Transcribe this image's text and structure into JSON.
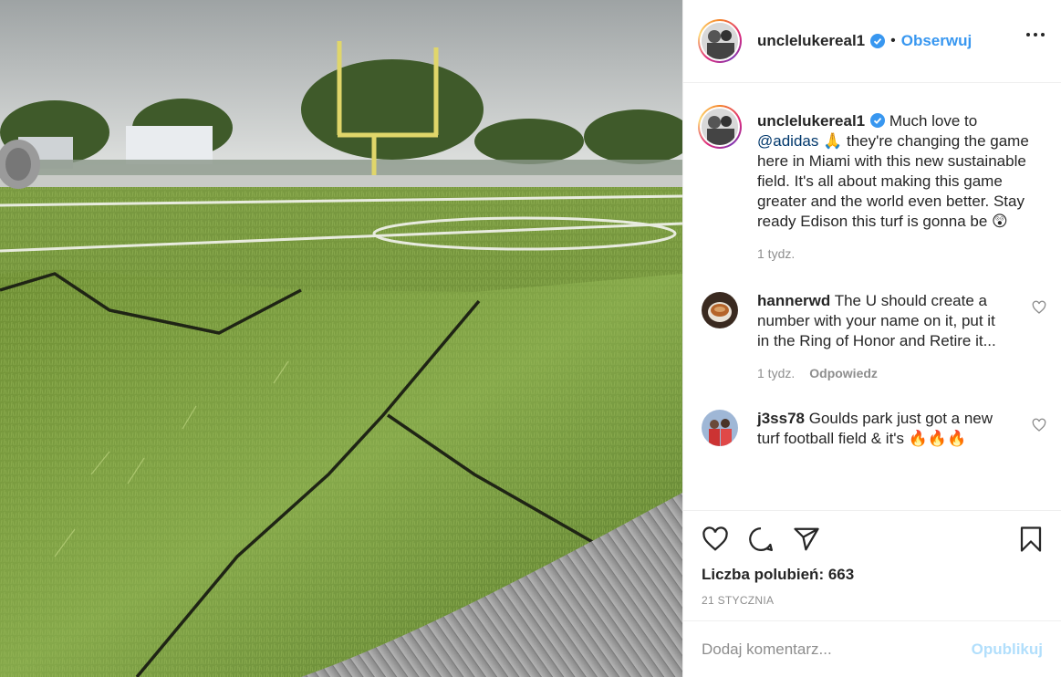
{
  "post": {
    "username": "unclelukereal1",
    "follow_label": "Obserwuj",
    "separator": "•"
  },
  "caption": {
    "username": "unclelukereal1",
    "text_before_mention": " Much love to ",
    "mention": "@adidas",
    "text_after_mention": " 🙏 they're changing the game here in Miami with this new sustainable field. It's all about making this game greater and the world even better. Stay ready Edison this turf is gonna be 😲",
    "time": "1 tydz."
  },
  "comments": [
    {
      "username": "hannerwd",
      "text": " The U should create a number with your name on it, put it in the Ring of Honor and Retire it...",
      "time": "1 tydz.",
      "reply_label": "Odpowiedz",
      "avatar_icon": "coffee-cup-avatar"
    },
    {
      "username": "j3ss78",
      "text": " Goulds park just got a new turf football field & it's 🔥🔥🔥",
      "avatar_icon": "group-photo-avatar"
    }
  ],
  "actions": {
    "like_icon": "heart-icon",
    "comment_icon": "comment-icon",
    "share_icon": "paper-plane-icon",
    "save_icon": "bookmark-icon"
  },
  "likes_text": "Liczba polubień: 663",
  "date": "21 STYCZNIA",
  "add_comment": {
    "placeholder": "Dodaj komentarz...",
    "publish_label": "Opublikuj"
  },
  "colors": {
    "link_blue": "#3897f0",
    "publish_disabled": "#b2dffc",
    "muted": "#8e8e8e",
    "verified": "#3897f0"
  }
}
